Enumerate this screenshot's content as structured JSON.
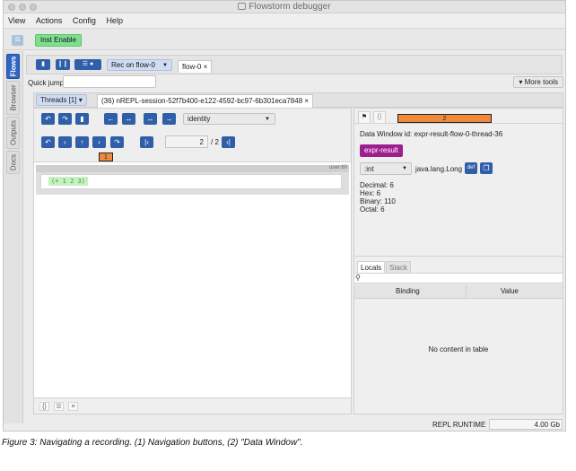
{
  "window": {
    "title": "Flowstorm debugger"
  },
  "menu": [
    "View",
    "Actions",
    "Config",
    "Help"
  ],
  "toolbar": {
    "inst_enable": "Inst Enable"
  },
  "sidebar_tabs": [
    "Flows",
    "Browser",
    "Outputs",
    "Docs"
  ],
  "flows": {
    "rec_label": "Rec on flow-0",
    "flow_tab": "flow-0 ×",
    "quick_jump_label": "Quick jump:",
    "more_tools": "▾ More tools",
    "threads_label": "Threads [1] ▾",
    "session_tab": "(36) nREPL-session-52f7b400-e122-4592-bc97-6b301eca7848 ×"
  },
  "code": {
    "fn_select": "identity",
    "index_value": "2",
    "index_total": "/ 2",
    "user_tag": "user:60",
    "expr": "(+ 1 2 3)"
  },
  "callouts": {
    "one": "1",
    "two": "2"
  },
  "data_window": {
    "id_text": "Data Window id: expr-result-flow-0-thread-36",
    "expr_button": "expr-result",
    "type_select": ":int",
    "type_name": "java.lang.Long",
    "def_button": "def",
    "decimal": "Decimal: 6",
    "hex": "Hex: 6",
    "binary": "Binary: 110",
    "octal": "Octal: 6"
  },
  "locals": {
    "tab_locals": "Locals",
    "tab_stack": "Stack",
    "col_binding": "Binding",
    "col_value": "Value",
    "empty": "No content in table"
  },
  "status": {
    "repl": "REPL",
    "runtime": "RUNTIME",
    "memory": "4.00 Gb"
  },
  "caption": "Figure 3: Navigating a recording. (1) Navigation buttons, (2) \"Data Window\"."
}
